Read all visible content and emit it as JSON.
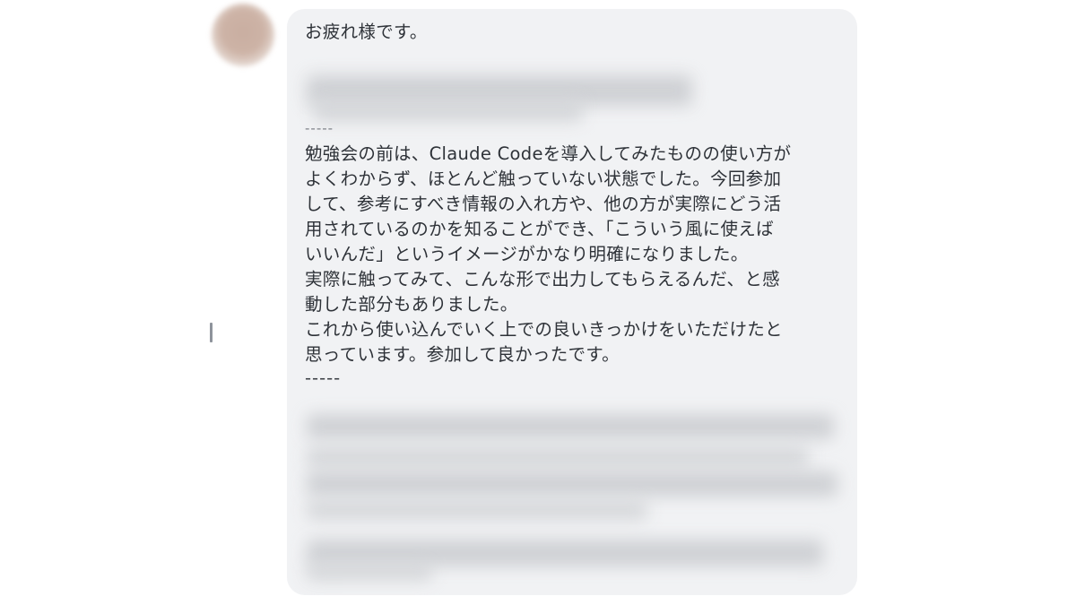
{
  "message": {
    "greeting": "お疲れ様です。",
    "divider_top": "-----",
    "body_lines": [
      "勉強会の前は、Claude Codeを導入してみたものの使い方が",
      "よくわからず、ほとんど触っていない状態でした。今回参加",
      "して、参考にすべき情報の入れ方や、他の方が実際にどう活",
      "用されているのかを知ることができ、「こういう風に使えば",
      "いいんだ」というイメージがかなり明確になりました。",
      "実際に触ってみて、こんな形で出力してもらえるんだ、と感",
      "動した部分もありました。",
      "これから使い込んでいく上での良いきっかけをいただけたと",
      "思っています。参加して良かったです。"
    ],
    "divider_bottom": "-----"
  },
  "colors": {
    "bubble_background": "#f1f2f4",
    "text": "#2e3238",
    "avatar": "#c9aea1"
  }
}
